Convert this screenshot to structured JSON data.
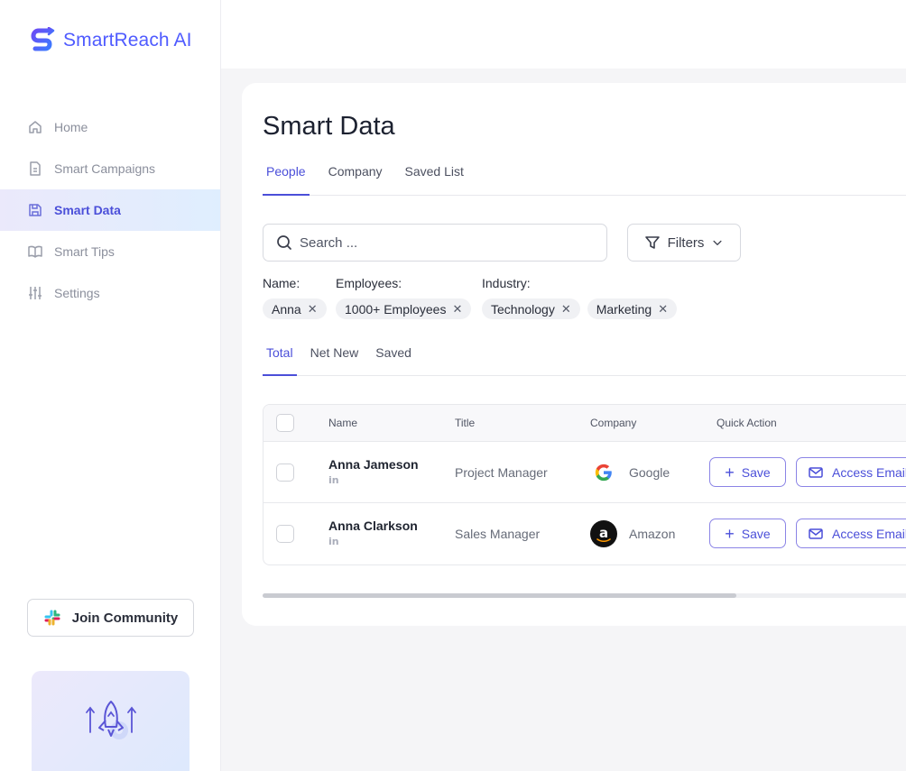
{
  "brand": {
    "name": "SmartReach AI",
    "color": "#4f5bff"
  },
  "sidebar": {
    "items": [
      {
        "label": "Home",
        "icon": "home-icon"
      },
      {
        "label": "Smart Campaigns",
        "icon": "document-icon"
      },
      {
        "label": "Smart Data",
        "icon": "save-icon",
        "active": true
      },
      {
        "label": "Smart Tips",
        "icon": "book-icon"
      },
      {
        "label": "Settings",
        "icon": "sliders-icon"
      }
    ],
    "community_label": "Join Community"
  },
  "main": {
    "title": "Smart Data",
    "tabs": [
      "People",
      "Company",
      "Saved List"
    ],
    "active_tab": "People",
    "search": {
      "placeholder": "Search ...",
      "value": ""
    },
    "filters_label": "Filters",
    "filter_groups": [
      {
        "label": "Name:",
        "chips": [
          "Anna"
        ]
      },
      {
        "label": "Employees:",
        "chips": [
          "1000+ Employees"
        ]
      },
      {
        "label": "Industry:",
        "chips": [
          "Technology",
          "Marketing"
        ]
      }
    ],
    "subtabs": [
      "Total",
      "Net New",
      "Saved"
    ],
    "active_subtab": "Total",
    "table": {
      "columns": [
        "Name",
        "Title",
        "Company",
        "Quick Action"
      ],
      "rows": [
        {
          "name": "Anna Jameson",
          "title": "Project Manager",
          "company": "Google",
          "company_icon": "google-icon"
        },
        {
          "name": "Anna Clarkson",
          "title": "Sales Manager",
          "company": "Amazon",
          "company_icon": "amazon-icon"
        }
      ],
      "save_label": "Save",
      "email_label": "Access Email",
      "linkedin_label": "in"
    }
  },
  "colors": {
    "accent": "#4b4fd9",
    "active_bg_start": "#ebe9fb",
    "active_bg_end": "#dfeefe"
  }
}
